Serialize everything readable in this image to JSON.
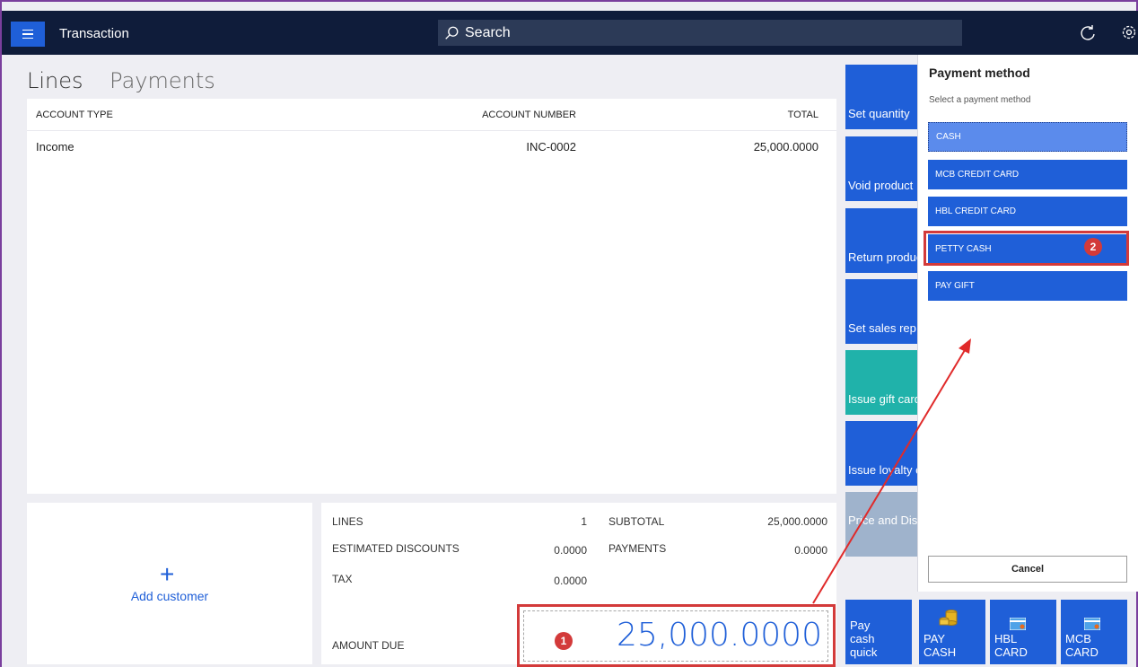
{
  "header": {
    "title": "Transaction",
    "search_placeholder": "Search"
  },
  "tabs": [
    {
      "label": "Lines"
    },
    {
      "label": "Payments"
    }
  ],
  "lines_table": {
    "columns": [
      "ACCOUNT TYPE",
      "ACCOUNT NUMBER",
      "TOTAL"
    ],
    "rows": [
      {
        "account_type": "Income",
        "account_number": "INC-0002",
        "total": "25,000.0000"
      }
    ]
  },
  "customer": {
    "add_label": "Add customer"
  },
  "totals": {
    "lines_label": "LINES",
    "lines_value": "1",
    "subtotal_label": "SUBTOTAL",
    "subtotal_value": "25,000.0000",
    "discounts_label": "ESTIMATED DISCOUNTS",
    "discounts_value": "0.0000",
    "payments_label": "PAYMENTS",
    "payments_value": "0.0000",
    "tax_label": "TAX",
    "tax_value": "0.0000",
    "amount_due_label": "AMOUNT DUE",
    "amount_due_value": "25,000.0000"
  },
  "actions": [
    {
      "label": "Set quantity",
      "color": "#1f5fd8"
    },
    {
      "label": "Void product",
      "color": "#1f5fd8"
    },
    {
      "label": "Return product",
      "color": "#1f5fd8"
    },
    {
      "label": "Set sales rep",
      "color": "#1f5fd8"
    },
    {
      "label": "Issue gift card",
      "color": "#20b2aa"
    },
    {
      "label": "Issue loyalty card",
      "color": "#1f5fd8"
    },
    {
      "label": "Price and Discounts",
      "color": "#9fb3cc"
    }
  ],
  "payment_panel": {
    "title": "Payment method",
    "subtitle": "Select a payment method",
    "methods": [
      "CASH",
      "MCB CREDIT CARD",
      "HBL CREDIT CARD",
      "PETTY CASH",
      "PAY GIFT"
    ],
    "selected": "CASH",
    "cancel_label": "Cancel"
  },
  "payment_tiles": [
    {
      "line1": "Pay",
      "line2": "cash",
      "line3": "quick"
    },
    {
      "line1": "PAY",
      "line2": "CASH",
      "icon": "coins-icon"
    },
    {
      "line1": "HBL",
      "line2": "CARD",
      "icon": "card-icon"
    },
    {
      "line1": "MCB",
      "line2": "CARD",
      "icon": "card-icon"
    }
  ],
  "annotations": {
    "badge1": "1",
    "badge2": "2",
    "accent": "#d33a3a"
  }
}
